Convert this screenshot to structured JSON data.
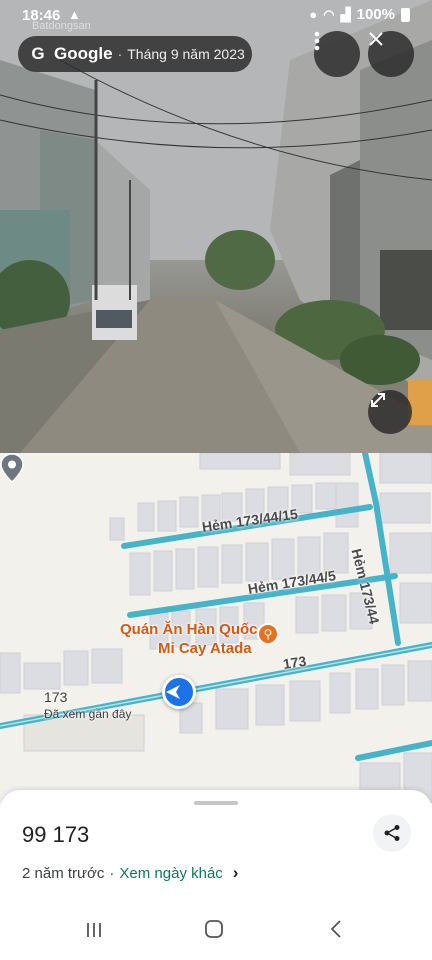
{
  "status_bar": {
    "time": "18:46",
    "battery": "100%",
    "icons": [
      "warning-icon",
      "location-icon",
      "wifi-icon",
      "signal-icon",
      "battery-icon"
    ]
  },
  "watermark": "Batdongsan",
  "header": {
    "brand": "Google",
    "separator": "·",
    "capture_date": "Tháng 9 năm 2023"
  },
  "map": {
    "streets": [
      "Hẻm 173/44/15",
      "Hẻm 173/44/5",
      "Hẻm 173/44",
      "173"
    ],
    "poi": {
      "name_line1": "Quán Ăn Hàn Quốc",
      "name_line2": "Mi Cay Atada",
      "icon": "restaurant-icon"
    },
    "place": {
      "name": "173",
      "subtitle": "Đã xem gần đây"
    },
    "road_color": "#46b4c8"
  },
  "sheet": {
    "title": "99 173",
    "time_ago": "2 năm trước",
    "separator": "·",
    "other_dates": "Xem ngày khác"
  },
  "nav": {
    "recents": "|||",
    "home": "○",
    "back": "<"
  }
}
